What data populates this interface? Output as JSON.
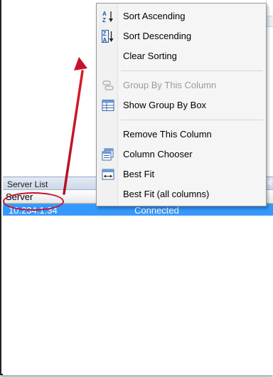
{
  "context_menu": {
    "items": [
      {
        "label": "Sort Ascending",
        "icon": "sort-ascending-icon",
        "enabled": true
      },
      {
        "label": "Sort Descending",
        "icon": "sort-descending-icon",
        "enabled": true
      },
      {
        "label": "Clear Sorting",
        "icon": "",
        "enabled": true
      },
      {
        "label": "Group By This Column",
        "icon": "group-by-column-icon",
        "enabled": false
      },
      {
        "label": "Show Group By Box",
        "icon": "group-by-box-icon",
        "enabled": true
      },
      {
        "label": "Remove This Column",
        "icon": "",
        "enabled": true
      },
      {
        "label": "Column Chooser",
        "icon": "column-chooser-icon",
        "enabled": true
      },
      {
        "label": "Best Fit",
        "icon": "best-fit-icon",
        "enabled": true
      },
      {
        "label": "Best Fit (all columns)",
        "icon": "",
        "enabled": true
      }
    ]
  },
  "panel": {
    "title": "Server List",
    "column_header": "Server",
    "rows": [
      {
        "server": "10.234.1.34",
        "status": "Connected",
        "selected": true
      }
    ]
  },
  "colors": {
    "selection": "#3399ff",
    "annotation": "#c8102e"
  }
}
